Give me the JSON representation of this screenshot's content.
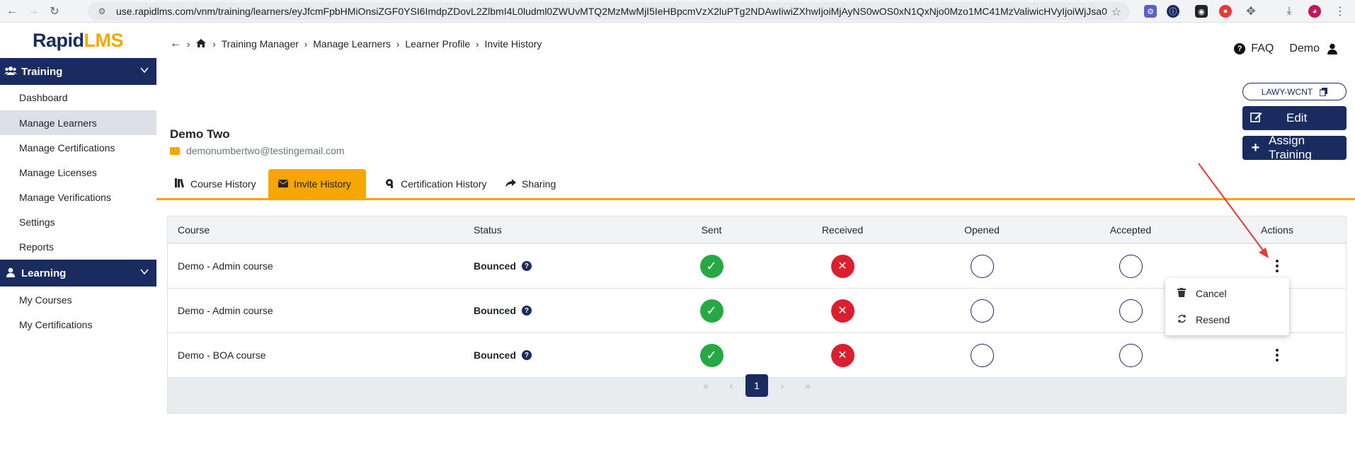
{
  "browser": {
    "url": "use.rapidlms.com/vnm/training/learners/eyJfcmFpbHMiOnsiZGF0YSI6ImdpZDovL2ZlbmI4L0ludml0ZWUvMTQ2MzMwMjI5IeHBpcmVzX2luPTg2NDAwIiwiZXhwIjoiMjAyNS0wOS0xN1QxNjo0Mzo1MC41MzValiwicHVyIjoiWjJsa09p..."
  },
  "logo": {
    "rapid": "Rapid",
    "lms": "LMS"
  },
  "sidebar": {
    "training_label": "Training",
    "training_items": [
      "Dashboard",
      "Manage Learners",
      "Manage Certifications",
      "Manage Licenses",
      "Manage Verifications",
      "Settings",
      "Reports"
    ],
    "learning_label": "Learning",
    "learning_items": [
      "My Courses",
      "My Certifications"
    ]
  },
  "breadcrumb": [
    "Training Manager",
    "Manage Learners",
    "Learner Profile",
    "Invite History"
  ],
  "header": {
    "faq": "FAQ",
    "user": "Demo"
  },
  "profile": {
    "name": "Demo Two",
    "email": "demonumbertwo@testingemail.com",
    "code": "LAWY-WCNT",
    "edit_label": "Edit",
    "assign_label": "Assign Training"
  },
  "tabs": [
    "Course History",
    "Invite History",
    "Certification History",
    "Sharing"
  ],
  "table": {
    "headers": [
      "Course",
      "Status",
      "Sent",
      "Received",
      "Opened",
      "Accepted",
      "Actions"
    ],
    "rows": [
      {
        "course": "Demo - Admin course",
        "status": "Bounced",
        "sent": "ok",
        "received": "bad",
        "opened": "empty",
        "accepted": "empty"
      },
      {
        "course": "Demo - Admin course",
        "status": "Bounced",
        "sent": "ok",
        "received": "bad",
        "opened": "empty",
        "accepted": "empty"
      },
      {
        "course": "Demo - BOA course",
        "status": "Bounced",
        "sent": "ok",
        "received": "bad",
        "opened": "empty",
        "accepted": "empty"
      }
    ]
  },
  "pagination": {
    "first": "«",
    "prev": "‹",
    "current": "1",
    "next": "›",
    "last": "»"
  },
  "actions_menu": {
    "cancel": "Cancel",
    "resend": "Resend"
  },
  "colors": {
    "navy": "#1a2b5f",
    "accent": "#f7a600",
    "success": "#28a745",
    "danger": "#dc1f2e"
  }
}
